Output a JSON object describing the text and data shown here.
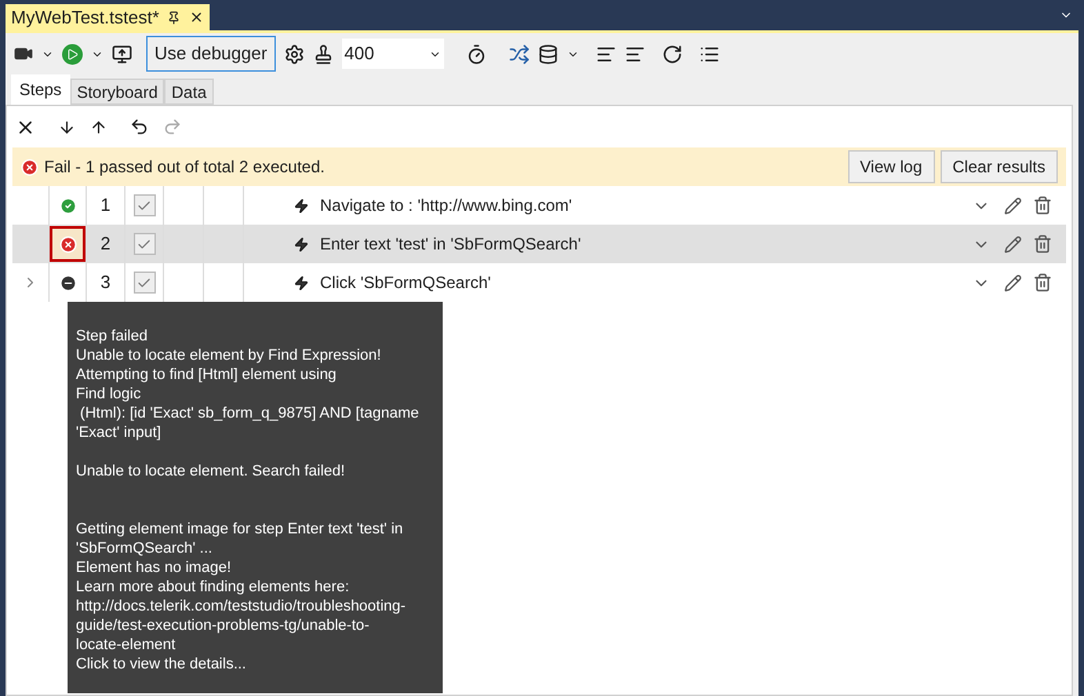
{
  "document_tab": {
    "title": "MyWebTest.tstest*"
  },
  "toolbar": {
    "debugger_button": "Use debugger",
    "delay_value": "400"
  },
  "tabs": [
    {
      "label": "Steps",
      "selected": true
    },
    {
      "label": "Storyboard",
      "selected": false
    },
    {
      "label": "Data",
      "selected": false
    }
  ],
  "result_banner": {
    "message": "Fail - 1 passed out of total 2 executed.",
    "buttons": [
      "View log",
      "Clear results"
    ]
  },
  "steps": [
    {
      "number": "1",
      "kind": "passed",
      "enabled": true,
      "highlighted": false,
      "expandable": false,
      "text": "Navigate to : 'http://www.bing.com'"
    },
    {
      "number": "2",
      "kind": "failed",
      "enabled": true,
      "highlighted": true,
      "expandable": false,
      "text": "Enter text 'test' in 'SbFormQSearch'"
    },
    {
      "number": "3",
      "kind": "not_run",
      "enabled": true,
      "highlighted": false,
      "expandable": true,
      "text": "Click 'SbFormQSearch'"
    }
  ],
  "tooltip": {
    "paragraphs": [
      [
        "Step failed",
        "Unable to locate element by Find Expression!",
        "Attempting to find [Html] element using",
        "Find logic",
        " (Html): [id 'Exact' sb_form_q_9875] AND [tagname",
        "'Exact' input]"
      ],
      [
        "Unable to locate element. Search failed!"
      ],
      [
        "Getting element image for step Enter text 'test' in",
        "'SbFormQSearch' ...",
        "Element has no image!",
        "Learn more about finding elements here:",
        "http://docs.telerik.com/teststudio/troubleshooting-",
        "guide/test-execution-problems-tg/unable-to-",
        "locate-element",
        "Click to view the details..."
      ]
    ]
  }
}
